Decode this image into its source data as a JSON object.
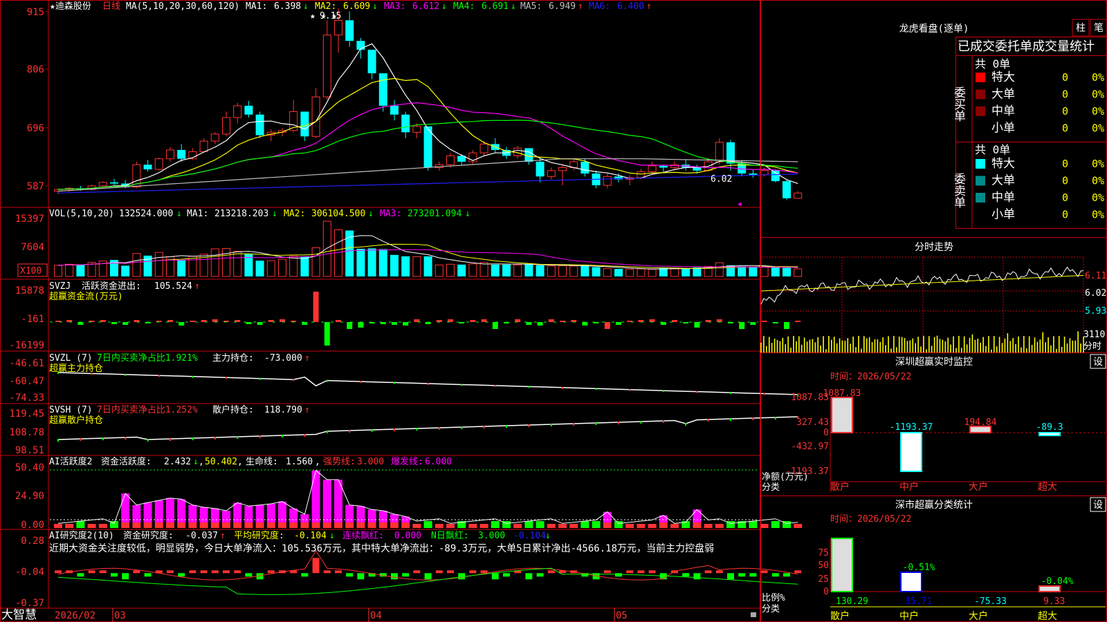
{
  "colors": {
    "up": "#ff3232",
    "down": "#00ffff",
    "frame": "#c8000e",
    "axis_text": "#ff3232",
    "ma1": "#ffffff",
    "ma2": "#ffff00",
    "ma3": "#ff00ff",
    "ma4": "#00ff00",
    "ma5": "#c0c0c0",
    "ma6": "#2020ff",
    "green": "#00ff00",
    "magenta": "#ff00ff",
    "yellow": "#ffff00",
    "cyan": "#00ffff",
    "white": "#ffffff",
    "blue": "#0000ff"
  },
  "main_chart": {
    "stock_name": "★迪森股份",
    "period": "日线",
    "ma_label": "MA(5,10,20,30,60,120)",
    "ma_values": [
      {
        "label": "MA1:",
        "value": "6.398",
        "arrow": "↓"
      },
      {
        "label": "MA2:",
        "value": "6.609",
        "arrow": "↓"
      },
      {
        "label": "MA3:",
        "value": "6.612",
        "arrow": "↓"
      },
      {
        "label": "MA4:",
        "value": "6.691",
        "arrow": "↓"
      },
      {
        "label": "MA5:",
        "value": "6.949",
        "arrow": "↑"
      },
      {
        "label": "MA6:",
        "value": "6.400",
        "arrow": "↑"
      }
    ],
    "y_ticks": [
      "915",
      "806",
      "696",
      "587"
    ],
    "high_label": "9.15",
    "low_label": "6.02",
    "high_markers": "★ ★ ★"
  },
  "vol_panel": {
    "title": "VOL(5,10,20)",
    "value": "132524.000",
    "items": [
      {
        "label": "MA1:",
        "value": "213218.203",
        "arrow": "↓"
      },
      {
        "label": "MA2:",
        "value": "306104.500",
        "arrow": "↓"
      },
      {
        "label": "MA3:",
        "value": "273201.094",
        "arrow": "↓"
      }
    ],
    "y_ticks": [
      "15397",
      "7604"
    ],
    "unit": "X100"
  },
  "svzj_panel": {
    "title": "SVZJ",
    "desc": "活跃资金进出:",
    "value": "105.524",
    "arrow": "↑",
    "subtitle": "超赢资金流(万元)",
    "y_ticks": [
      "15878",
      "-161",
      "-16199"
    ]
  },
  "svzl_panel": {
    "title": "SVZL (7)",
    "text": "7日内买卖净占比1.921%",
    "label2": "主力持仓:",
    "value": "-73.000",
    "arrow": "↑",
    "subtitle": "超赢主力持仓",
    "y_ticks": [
      "-46.61",
      "-60.47",
      "-74.33"
    ]
  },
  "svsh_panel": {
    "title": "SVSH (7)",
    "text": "7日内买卖净占比1.252%",
    "label2": "散户持仓:",
    "value": "118.790",
    "arrow": "↑",
    "subtitle": "超赢散户持仓",
    "y_ticks": [
      "119.45",
      "108.78",
      "98.51"
    ]
  },
  "ai_active_panel": {
    "title": "AI活跃度2",
    "items": [
      {
        "label": "资金活跃度:",
        "value": "2.432",
        "arrow": "↓"
      },
      {
        "label": "",
        "value": "50.402",
        "arrow": ""
      },
      {
        "label": "生命线:",
        "value": "1.560",
        "arrow": ""
      },
      {
        "label": "强势线:",
        "value": "3.000",
        "arrow": ""
      },
      {
        "label": "爆发线:",
        "value": "6.000",
        "arrow": ""
      }
    ],
    "y_ticks": [
      "50.40",
      "24.90",
      "0.00"
    ]
  },
  "ai_research_panel": {
    "title": "AI研究度2(10)",
    "items": [
      {
        "label": "资金研究度:",
        "value": "-0.037",
        "arrow": "↑"
      },
      {
        "label": "平均研究度:",
        "value": "-0.104",
        "arrow": "↓"
      },
      {
        "label": "连续飘红:",
        "value": "0.000",
        "arrow": ""
      },
      {
        "label": "N日飘红:",
        "value": "3.000",
        "arrow": ""
      },
      {
        "label": "",
        "value": "-0.104",
        "arrow": "↓"
      }
    ],
    "summary": "近期大资金关注度较低，明显弱势，今日大单净流入：105.536万元，其中特大单净流出：-89.3万元，大单5日累计净出-4566.18万元，当前主力控盘弱",
    "y_ticks": [
      "0.28",
      "-0.04",
      "-0.37"
    ]
  },
  "x_axis": {
    "app_name": "大智慧",
    "labels": [
      "2026/02",
      "03",
      "04",
      "05"
    ]
  },
  "longhu": {
    "title": "龙虎看盘(逐单)",
    "btn_zhu": "柱",
    "btn_ce": "笔",
    "header": "已成交委托单成交量统计",
    "buy_label": "委买单",
    "sell_label": "委卖单",
    "buy_total": "共 0单",
    "sell_total": "共 0单",
    "rows": [
      {
        "name": "特大",
        "count": "0",
        "pct": "0%"
      },
      {
        "name": "大单",
        "count": "0",
        "pct": "0%"
      },
      {
        "name": "中单",
        "count": "0",
        "pct": "0%"
      },
      {
        "name": "小单",
        "count": "0",
        "pct": "0%"
      }
    ]
  },
  "intraday": {
    "title": "分时走势",
    "y_ticks": [
      "6.11",
      "6.02",
      "5.93"
    ],
    "vol_label": "3110",
    "time_label": "分时"
  },
  "sz_monitor": {
    "title": "深圳超赢实时监控",
    "btn": "设",
    "time_label": "时间：2026/05/22",
    "y_ticks": [
      "1087.83",
      "327.43",
      "0",
      "-432.97",
      "-1193.37"
    ],
    "axis_label_1": "净额(万元)",
    "axis_label_2": "分类",
    "categories": [
      "散户",
      "中户",
      "大户",
      "超大"
    ],
    "values": [
      1087.83,
      -1193.37,
      194.84,
      -89.3
    ],
    "value_labels": [
      "1087.83",
      "-1193.37",
      "194.84",
      "-89.3"
    ]
  },
  "sz_classify": {
    "title": "深市超赢分类统计",
    "btn": "设",
    "time_label": "时间：2026/05/22",
    "y_ticks": [
      "75",
      "50",
      "25",
      "0"
    ],
    "axis_label_1": "比例%",
    "axis_label_2": "分类",
    "categories": [
      "散户",
      "中户",
      "大户",
      "超大"
    ],
    "bar_values": [
      130.29,
      35.71,
      -75.33,
      9.33
    ],
    "bar_labels": [
      "130.29",
      "35.71",
      "-75.33",
      "9.33"
    ],
    "pct_labels": [
      "",
      "-0.51%",
      "",
      "-0.04%"
    ]
  },
  "chart_data": {
    "type": "candlestick",
    "title": "迪森股份 日线",
    "candles": [
      [
        6.05,
        6.1,
        6.0,
        6.08
      ],
      [
        6.08,
        6.12,
        6.04,
        6.1
      ],
      [
        6.1,
        6.14,
        6.06,
        6.08
      ],
      [
        6.08,
        6.16,
        6.06,
        6.14
      ],
      [
        6.14,
        6.22,
        6.12,
        6.2
      ],
      [
        6.2,
        6.26,
        6.15,
        6.18
      ],
      [
        6.18,
        6.24,
        6.1,
        6.12
      ],
      [
        6.12,
        6.55,
        6.1,
        6.5
      ],
      [
        6.5,
        6.58,
        6.38,
        6.42
      ],
      [
        6.42,
        6.62,
        6.4,
        6.6
      ],
      [
        6.6,
        6.8,
        6.55,
        6.75
      ],
      [
        6.75,
        6.85,
        6.55,
        6.6
      ],
      [
        6.6,
        6.78,
        6.58,
        6.72
      ],
      [
        6.72,
        6.95,
        6.7,
        6.9
      ],
      [
        6.9,
        7.05,
        6.85,
        7.02
      ],
      [
        7.02,
        7.4,
        6.98,
        7.3
      ],
      [
        7.3,
        7.55,
        7.2,
        7.5
      ],
      [
        7.5,
        7.58,
        7.3,
        7.35
      ],
      [
        7.35,
        7.4,
        6.95,
        7.0
      ],
      [
        7.0,
        7.1,
        6.9,
        7.05
      ],
      [
        7.05,
        7.12,
        6.98,
        7.08
      ],
      [
        7.08,
        7.6,
        7.05,
        7.4
      ],
      [
        7.4,
        7.35,
        6.9,
        6.98
      ],
      [
        6.98,
        7.8,
        6.95,
        7.65
      ],
      [
        7.65,
        8.95,
        7.6,
        8.7
      ],
      [
        8.7,
        9.15,
        8.4,
        8.95
      ],
      [
        8.95,
        9.1,
        8.5,
        8.6
      ],
      [
        8.6,
        8.65,
        8.3,
        8.45
      ],
      [
        8.45,
        8.4,
        7.95,
        8.05
      ],
      [
        8.05,
        8.0,
        7.4,
        7.5
      ],
      [
        7.5,
        7.6,
        7.25,
        7.35
      ],
      [
        7.35,
        7.4,
        6.95,
        7.05
      ],
      [
        7.05,
        7.2,
        6.95,
        7.15
      ],
      [
        7.15,
        7.12,
        6.4,
        6.45
      ],
      [
        6.45,
        6.55,
        6.4,
        6.5
      ],
      [
        6.5,
        6.7,
        6.45,
        6.65
      ],
      [
        6.65,
        6.68,
        6.5,
        6.55
      ],
      [
        6.55,
        6.75,
        6.5,
        6.7
      ],
      [
        6.7,
        6.9,
        6.65,
        6.85
      ],
      [
        6.85,
        6.95,
        6.7,
        6.75
      ],
      [
        6.75,
        6.8,
        6.6,
        6.65
      ],
      [
        6.65,
        6.82,
        6.6,
        6.78
      ],
      [
        6.78,
        6.75,
        6.5,
        6.55
      ],
      [
        6.55,
        6.6,
        6.2,
        6.3
      ],
      [
        6.3,
        6.45,
        6.25,
        6.4
      ],
      [
        6.4,
        6.5,
        6.15,
        6.45
      ],
      [
        6.45,
        6.6,
        6.4,
        6.55
      ],
      [
        6.55,
        6.6,
        6.3,
        6.35
      ],
      [
        6.35,
        6.4,
        6.1,
        6.15
      ],
      [
        6.15,
        6.35,
        6.1,
        6.3
      ],
      [
        6.3,
        6.35,
        6.2,
        6.25
      ],
      [
        6.25,
        6.32,
        6.15,
        6.28
      ],
      [
        6.28,
        6.42,
        6.25,
        6.38
      ],
      [
        6.38,
        6.55,
        6.33,
        6.48
      ],
      [
        6.48,
        6.5,
        6.38,
        6.45
      ],
      [
        6.45,
        6.56,
        6.4,
        6.5
      ],
      [
        6.5,
        6.58,
        6.4,
        6.45
      ],
      [
        6.45,
        6.5,
        6.35,
        6.4
      ],
      [
        6.4,
        6.62,
        6.38,
        6.55
      ],
      [
        6.55,
        6.95,
        6.5,
        6.88
      ],
      [
        6.88,
        6.92,
        6.4,
        6.52
      ],
      [
        6.52,
        6.58,
        6.3,
        6.35
      ],
      [
        6.35,
        6.42,
        6.28,
        6.33
      ],
      [
        6.33,
        6.45,
        6.3,
        6.4
      ],
      [
        6.4,
        6.42,
        6.2,
        6.22
      ],
      [
        6.22,
        6.24,
        5.9,
        5.93
      ],
      [
        5.93,
        6.05,
        5.92,
        6.02
      ]
    ],
    "volume": [
      3100,
      3400,
      3200,
      3900,
      4300,
      4600,
      3000,
      6400,
      5800,
      6700,
      5500,
      4600,
      5600,
      6200,
      7700,
      7800,
      7000,
      6300,
      4400,
      4400,
      4800,
      5700,
      5600,
      8000,
      15397,
      13000,
      12800,
      7700,
      7800,
      7600,
      6000,
      5600,
      5500,
      5600,
      3200,
      3400,
      3300,
      3500,
      3900,
      3300,
      3300,
      3200,
      3400,
      3100,
      2900,
      3000,
      2900,
      2900,
      2600,
      2200,
      2100,
      2000,
      2100,
      2000,
      2300,
      2300,
      2200,
      2500,
      2800,
      3800,
      3100,
      2800,
      2600,
      2600,
      2500,
      2400,
      2100
    ],
    "y_range": [
      5.87,
      9.2
    ]
  }
}
